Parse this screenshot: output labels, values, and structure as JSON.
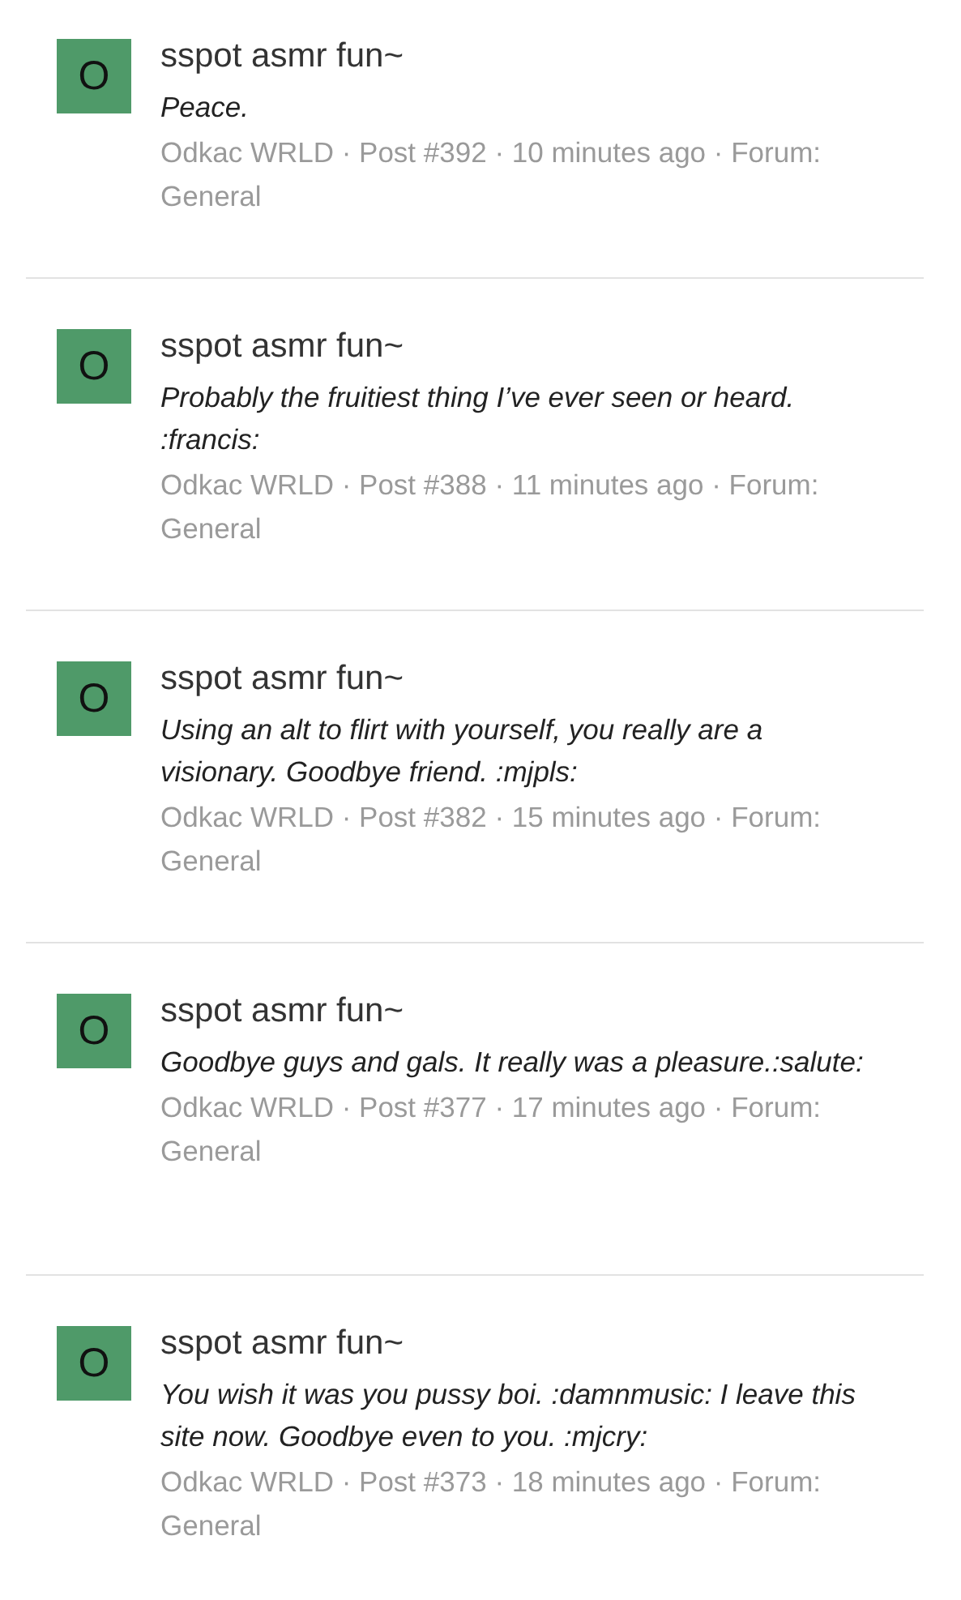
{
  "posts": [
    {
      "avatar": "O",
      "title": "sspot asmr fun~",
      "body": "Peace.",
      "meta": "Odkac WRLD · Post #392 · 10 minutes ago · Forum: General"
    },
    {
      "avatar": "O",
      "title": "sspot asmr fun~",
      "body": "Probably the fruitiest thing I’ve ever seen or heard. :francis:",
      "meta": "Odkac WRLD · Post #388 · 11 minutes ago · Forum: General"
    },
    {
      "avatar": "O",
      "title": "sspot asmr fun~",
      "body": "Using an alt to flirt with yourself, you really are a visionary. Goodbye friend. :mjpls:",
      "meta": "Odkac WRLD · Post #382 · 15 minutes ago · Forum: General"
    },
    {
      "avatar": "O",
      "title": "sspot asmr fun~",
      "body": "Goodbye guys and gals. It really was a pleasure.:salute:",
      "meta": "Odkac WRLD · Post #377 · 17 minutes ago · Forum: General"
    },
    {
      "avatar": "O",
      "title": "sspot asmr fun~",
      "body": "You wish it was you pussy boi. :damnmusic: I leave this site now. Goodbye even to you. :mjcry:",
      "meta": "Odkac WRLD · Post #373 · 18 minutes ago · Forum: General"
    }
  ]
}
